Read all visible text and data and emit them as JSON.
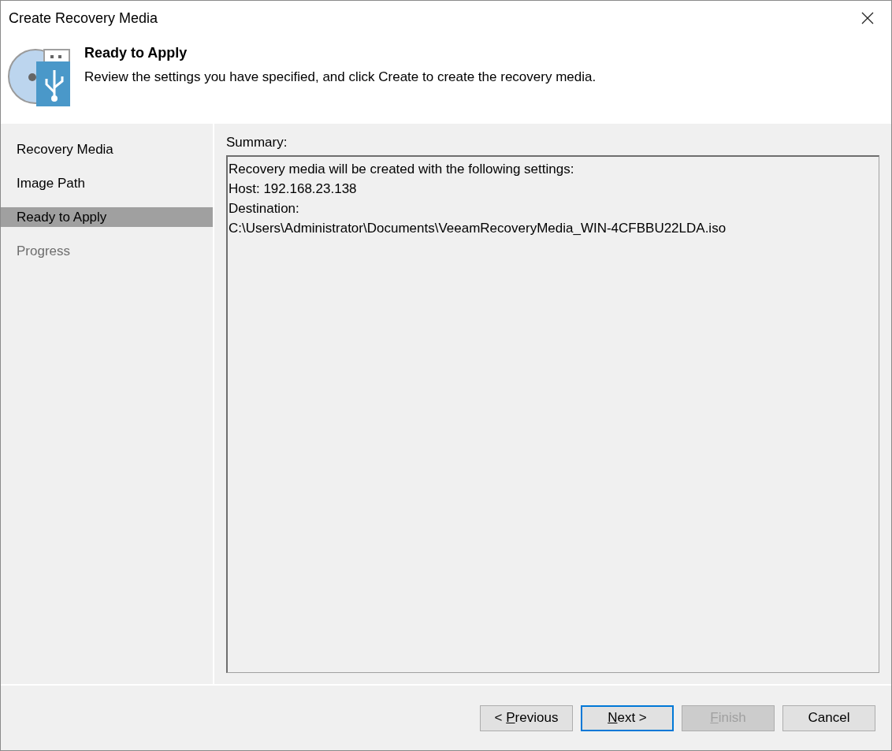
{
  "window": {
    "title": "Create Recovery Media"
  },
  "header": {
    "title": "Ready to Apply",
    "description": "Review the settings you have specified, and click Create to create the recovery media."
  },
  "steps": [
    {
      "label": "Recovery Media",
      "selected": false,
      "disabled": false
    },
    {
      "label": "Image Path",
      "selected": false,
      "disabled": false
    },
    {
      "label": "Ready to Apply",
      "selected": true,
      "disabled": false
    },
    {
      "label": "Progress",
      "selected": false,
      "disabled": true
    }
  ],
  "summary": {
    "label": "Summary:",
    "lines": [
      "Recovery media will be created with the following settings:",
      "Host: 192.168.23.138",
      "Destination:",
      "C:\\Users\\Administrator\\Documents\\VeeamRecoveryMedia_WIN-4CFBBU22LDA.iso"
    ]
  },
  "buttons": [
    {
      "before": "< ",
      "accel": "P",
      "after": "revious",
      "disabled": false,
      "focused": false
    },
    {
      "accel": "N",
      "after": "ext >",
      "disabled": false,
      "focused": true
    },
    {
      "accel": "F",
      "after": "inish",
      "disabled": true,
      "focused": false
    },
    {
      "after": "Cancel",
      "disabled": false,
      "focused": false
    }
  ]
}
